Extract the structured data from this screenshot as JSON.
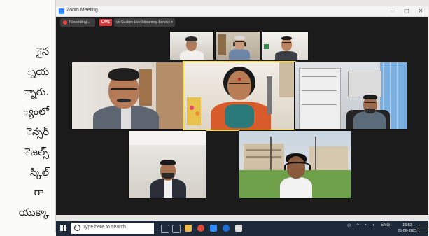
{
  "page_text": [
    "ైన",
    "్నయ",
    "్నారు.",
    "్యంలో",
    "ెన్సర్",
    "ెజల్స్",
    "స్కిల్",
    "గా",
    "యుక్కా"
  ],
  "window": {
    "title": "Zoom Meeting",
    "minimize": "—",
    "maximize": "□",
    "close": "✕"
  },
  "recording": {
    "label": "Recording...",
    "live_badge": "LIVE",
    "live_text": "on Custom Live Streaming Service ▾"
  },
  "taskbar": {
    "search_placeholder": "Type here to search",
    "tray_lang": "ENG",
    "time": "15:53",
    "date": "25-08-2021"
  },
  "colors": {
    "zoom_blue": "#2d8cff",
    "live_red": "#d83a3a",
    "speaker_highlight": "#f2d94a",
    "taskbar": "#1e2a3a"
  }
}
